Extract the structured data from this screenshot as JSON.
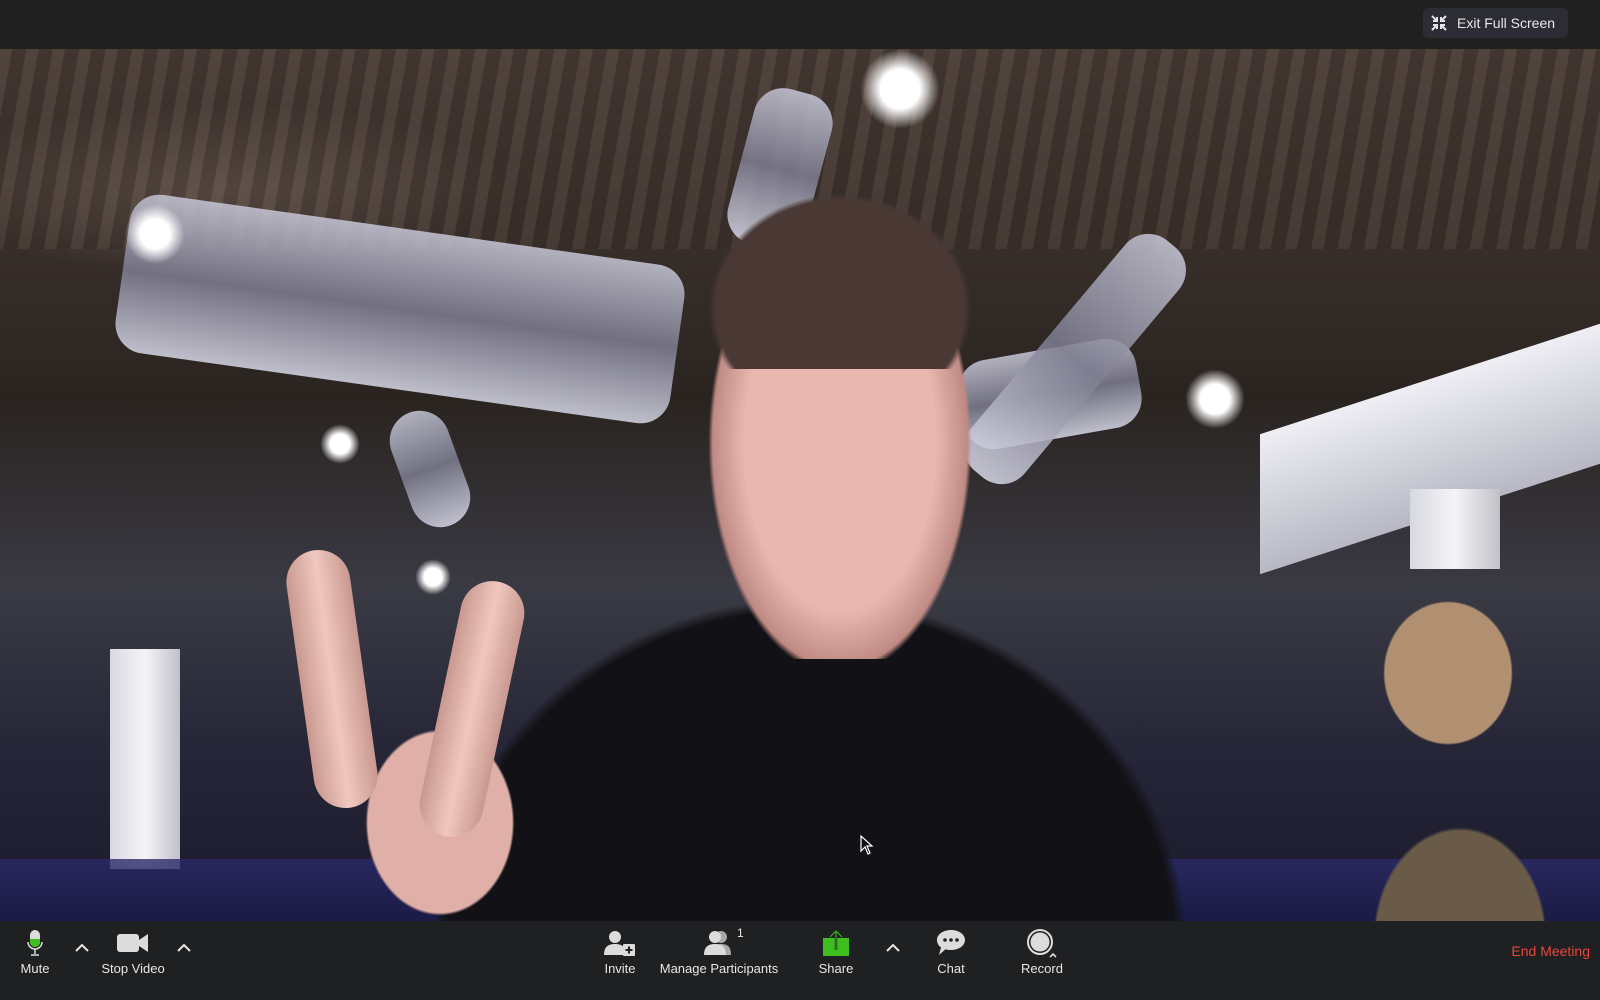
{
  "topbar": {
    "exit_full_screen_label": "Exit Full Screen",
    "exit_full_screen_icon": "exit-fullscreen-arrows-icon"
  },
  "video": {
    "description": "Self-view camera feed: man in black jacket making a peace sign in an office with exposed ceiling ducts",
    "cursor_icon": "pointer-cursor-icon"
  },
  "toolbar": {
    "mute": {
      "label": "Mute",
      "icon": "microphone-icon",
      "level_color": "#3fbf1f"
    },
    "stop_video": {
      "label": "Stop Video",
      "icon": "video-camera-icon"
    },
    "invite": {
      "label": "Invite",
      "icon": "add-user-icon"
    },
    "manage_participants": {
      "label": "Manage Participants",
      "icon": "participants-icon",
      "count": "1"
    },
    "share": {
      "label": "Share",
      "icon": "share-screen-icon",
      "color": "#3fbf1f"
    },
    "chat": {
      "label": "Chat",
      "icon": "chat-bubble-icon"
    },
    "record": {
      "label": "Record",
      "icon": "record-icon"
    },
    "end_meeting": {
      "label": "End Meeting",
      "color": "#e8453c"
    }
  }
}
